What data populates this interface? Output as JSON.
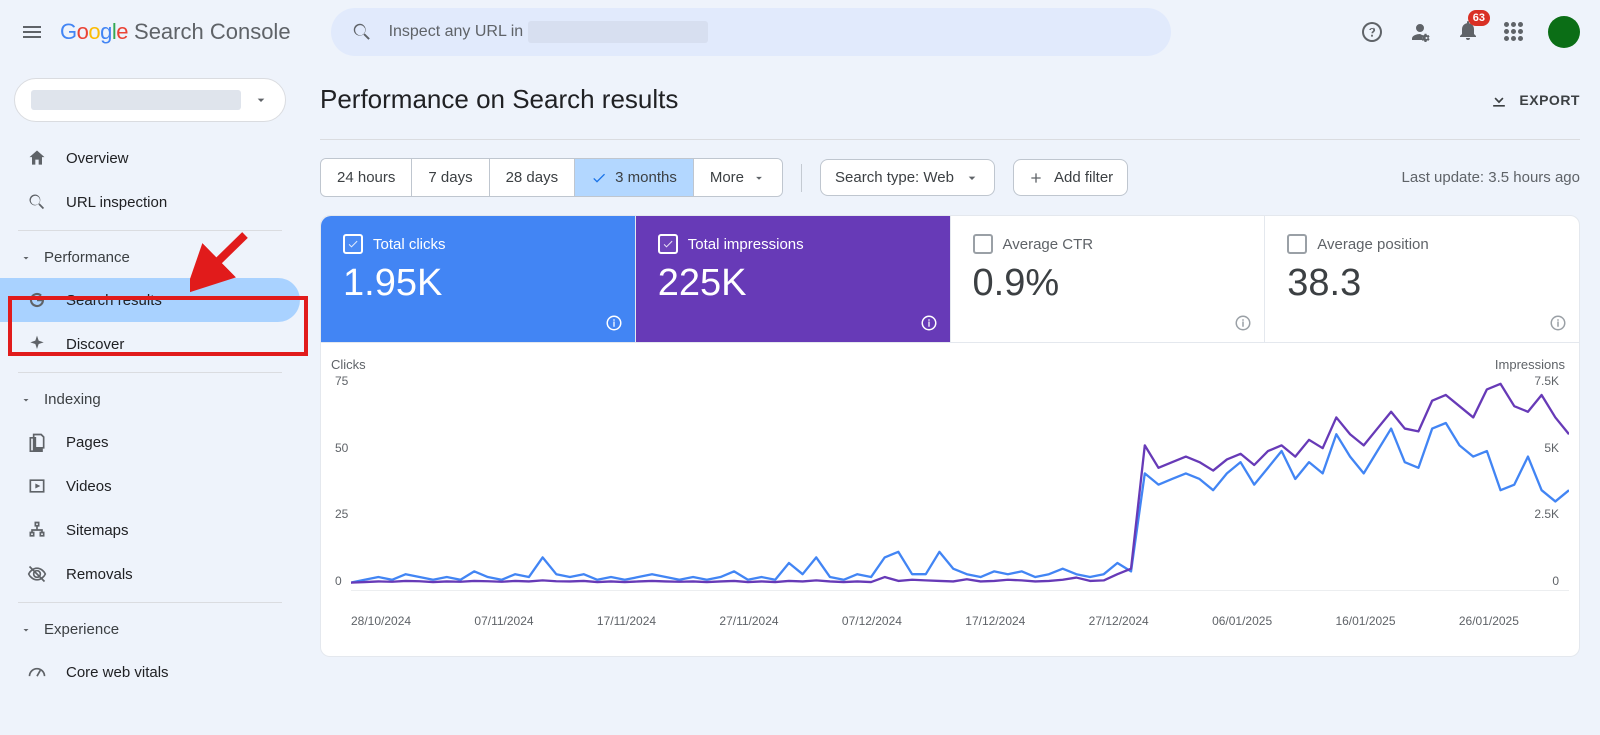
{
  "header": {
    "logo_product": "Search Console",
    "search_placeholder": "Inspect any URL in",
    "notifications_count": "63"
  },
  "sidebar": {
    "items": [
      {
        "label": "Overview"
      },
      {
        "label": "URL inspection"
      }
    ],
    "performance_header": "Performance",
    "performance_items": [
      {
        "label": "Search results"
      },
      {
        "label": "Discover"
      }
    ],
    "indexing_header": "Indexing",
    "indexing_items": [
      {
        "label": "Pages"
      },
      {
        "label": "Videos"
      },
      {
        "label": "Sitemaps"
      },
      {
        "label": "Removals"
      }
    ],
    "experience_header": "Experience",
    "experience_items": [
      {
        "label": "Core web vitals"
      }
    ]
  },
  "page": {
    "title": "Performance on Search results",
    "export": "EXPORT",
    "ranges": [
      "24 hours",
      "7 days",
      "28 days",
      "3 months",
      "More"
    ],
    "search_type": "Search type: Web",
    "add_filter": "Add filter",
    "last_update": "Last update: 3.5 hours ago"
  },
  "metrics": {
    "clicks": {
      "label": "Total clicks",
      "value": "1.95K",
      "checked": true
    },
    "impressions": {
      "label": "Total impressions",
      "value": "225K",
      "checked": true
    },
    "ctr": {
      "label": "Average CTR",
      "value": "0.9%",
      "checked": false
    },
    "position": {
      "label": "Average position",
      "value": "38.3",
      "checked": false
    }
  },
  "chart_data": {
    "type": "line",
    "left_axis_label": "Clicks",
    "right_axis_label": "Impressions",
    "left_ticks": [
      0,
      25,
      50,
      75
    ],
    "right_ticks": [
      0,
      2500,
      5000,
      7500
    ],
    "left_tick_labels": [
      "0",
      "25",
      "50",
      "75"
    ],
    "right_tick_labels": [
      "0",
      "2.5K",
      "5K",
      "7.5K"
    ],
    "x_labels": [
      "28/10/2024",
      "07/11/2024",
      "17/11/2024",
      "27/11/2024",
      "07/12/2024",
      "17/12/2024",
      "27/12/2024",
      "06/01/2025",
      "16/01/2025",
      "26/01/2025"
    ],
    "ylim_left": [
      0,
      75
    ],
    "ylim_right": [
      0,
      7500
    ],
    "series": [
      {
        "name": "Clicks",
        "axis": "left",
        "color": "#4285f4",
        "values": [
          3,
          4,
          5,
          4,
          6,
          5,
          4,
          5,
          4,
          7,
          5,
          4,
          6,
          5,
          12,
          6,
          5,
          6,
          4,
          5,
          4,
          5,
          6,
          5,
          4,
          5,
          4,
          5,
          7,
          4,
          5,
          4,
          10,
          6,
          12,
          5,
          4,
          6,
          5,
          12,
          14,
          6,
          6,
          14,
          8,
          6,
          5,
          7,
          6,
          7,
          5,
          6,
          8,
          6,
          5,
          6,
          10,
          7,
          42,
          38,
          40,
          42,
          40,
          36,
          42,
          46,
          38,
          44,
          50,
          40,
          46,
          42,
          56,
          48,
          42,
          50,
          58,
          46,
          44,
          58,
          60,
          52,
          48,
          50,
          36,
          38,
          48,
          36,
          32,
          36
        ]
      },
      {
        "name": "Impressions",
        "axis": "right",
        "color": "#673ab7",
        "values": [
          300,
          320,
          340,
          330,
          360,
          350,
          320,
          340,
          330,
          360,
          350,
          330,
          360,
          340,
          380,
          350,
          340,
          360,
          320,
          340,
          320,
          340,
          360,
          340,
          330,
          340,
          320,
          340,
          360,
          320,
          340,
          320,
          360,
          340,
          380,
          340,
          320,
          340,
          320,
          500,
          360,
          400,
          380,
          360,
          340,
          420,
          340,
          360,
          400,
          380,
          340,
          360,
          400,
          480,
          360,
          380,
          600,
          800,
          5200,
          4400,
          4600,
          4800,
          4600,
          4300,
          4700,
          4900,
          4500,
          5000,
          5200,
          4800,
          5400,
          5100,
          6200,
          5600,
          5200,
          5800,
          6400,
          5800,
          5700,
          6800,
          7000,
          6600,
          6200,
          7200,
          7400,
          6600,
          6400,
          7000,
          6200,
          5600
        ]
      }
    ]
  }
}
